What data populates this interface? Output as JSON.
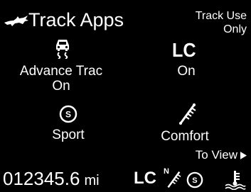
{
  "header": {
    "title": "Track Apps",
    "track_use_line1": "Track Use",
    "track_use_line2": "Only"
  },
  "apps": [
    {
      "icon": "traction-control-car-icon",
      "label_line1": "Advance  Trac",
      "label_line2": "On"
    },
    {
      "icon": "launch-control-icon",
      "icon_text": "LC",
      "label_line1": "On"
    },
    {
      "icon": "sport-steering-icon",
      "icon_text": "S",
      "label_line1": "Sport"
    },
    {
      "icon": "shock-absorber-icon",
      "label_line1": "Comfort"
    }
  ],
  "navigation": {
    "to_view_label": "To View"
  },
  "status_bar": {
    "odometer_value": "012345.6",
    "odometer_unit": "mi",
    "lc_indicator": "LC",
    "suspension_indicator_letter": "N",
    "steering_indicator_letter": "S"
  },
  "colors": {
    "background": "#000000",
    "foreground": "#ffffff"
  }
}
